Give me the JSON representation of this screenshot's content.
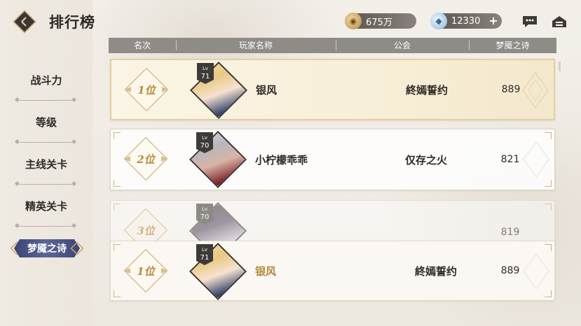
{
  "header": {
    "title": "排行榜",
    "currencies": [
      {
        "name": "gold",
        "value": "675万",
        "icon": "gold-coin-icon"
      },
      {
        "name": "crystal",
        "value": "12330",
        "icon": "crystal-icon",
        "plus": "+"
      }
    ]
  },
  "sidebar": {
    "items": [
      {
        "label": "战斗力"
      },
      {
        "label": "等级"
      },
      {
        "label": "主线关卡"
      },
      {
        "label": "精英关卡"
      },
      {
        "label": "梦魇之诗",
        "active": true
      }
    ]
  },
  "table": {
    "columns": [
      "名次",
      "玩家名称",
      "公会",
      "梦魇之诗"
    ],
    "rows": [
      {
        "rank": "1位",
        "lv_label": "Lv",
        "level": "71",
        "name": "银风",
        "guild": "終嫣誓约",
        "score": "889"
      },
      {
        "rank": "2位",
        "lv_label": "Lv",
        "level": "70",
        "name": "小柠檬乖乖",
        "guild": "仅存之火",
        "score": "821"
      },
      {
        "rank": "3位",
        "lv_label": "Lv",
        "level": "70",
        "name": "",
        "guild": "",
        "score": "819"
      }
    ],
    "self_row": {
      "rank": "1位",
      "lv_label": "Lv",
      "level": "71",
      "name": "银风",
      "guild": "終嫣誓约",
      "score": "889"
    }
  },
  "colors": {
    "accent_gold": "#b9893d",
    "active_tab": "#3c4575",
    "header_bar": "#8f8b87"
  }
}
